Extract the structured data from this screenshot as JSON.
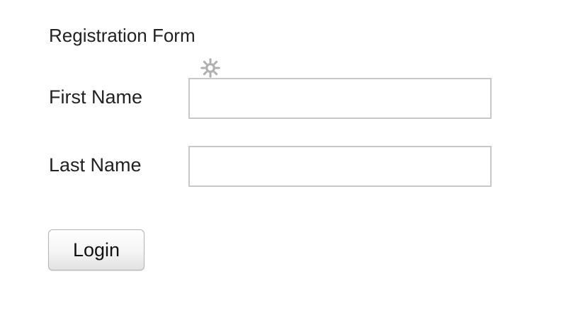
{
  "form": {
    "title": "Registration Form",
    "icons": {
      "settings": "gear-icon"
    },
    "fields": {
      "first_name": {
        "label": "First Name",
        "value": "",
        "placeholder": ""
      },
      "last_name": {
        "label": "Last Name",
        "value": "",
        "placeholder": ""
      }
    },
    "submit_label": "Login"
  },
  "colors": {
    "text": "#222222",
    "input_border": "#c8c8c8",
    "icon": "#b0b0b0",
    "button_border": "#b4b4b4"
  }
}
